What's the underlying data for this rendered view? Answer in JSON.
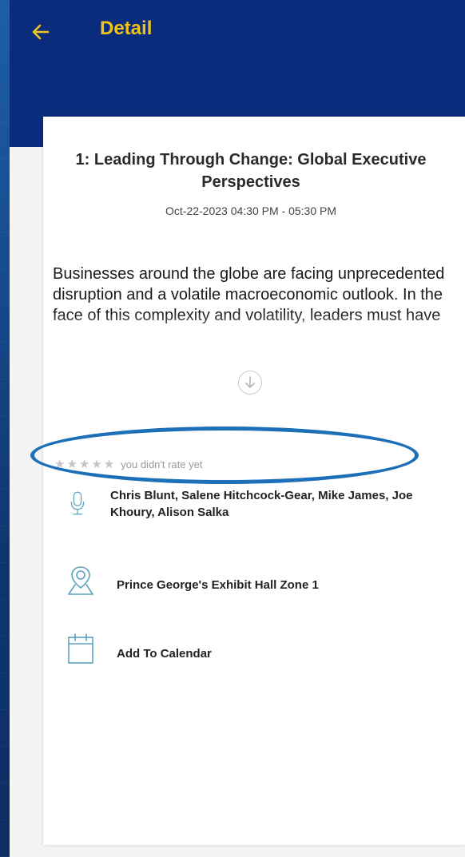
{
  "header": {
    "back_icon": "arrow-left-icon",
    "title": "Detail"
  },
  "session": {
    "title": "1: Leading Through Change: Global Executive Perspectives",
    "datetime": "Oct-22-2023   04:30 PM - 05:30 PM",
    "description": "Businesses around the globe are facing unprecedented disruption and a volatile macroeconomic outlook. In the face of this complexity and volatility, leaders must have"
  },
  "expand": {
    "icon": "chevron-down-circle-icon"
  },
  "rating": {
    "stars": "★★★★★",
    "value": 0,
    "max": 5,
    "status": "you didn't rate yet"
  },
  "speakers": {
    "icon": "microphone-icon",
    "names": "Chris Blunt, Salene Hitchcock-Gear, Mike James, Joe Khoury, Alison Salka"
  },
  "location": {
    "icon": "map-pin-icon",
    "name": "Prince George's Exhibit Hall Zone 1"
  },
  "calendar": {
    "icon": "calendar-icon",
    "label": "Add To Calendar"
  },
  "colors": {
    "header_bg": "#0b2b7c",
    "accent_yellow": "#f0c419",
    "highlight_blue": "#1d6fb8"
  }
}
